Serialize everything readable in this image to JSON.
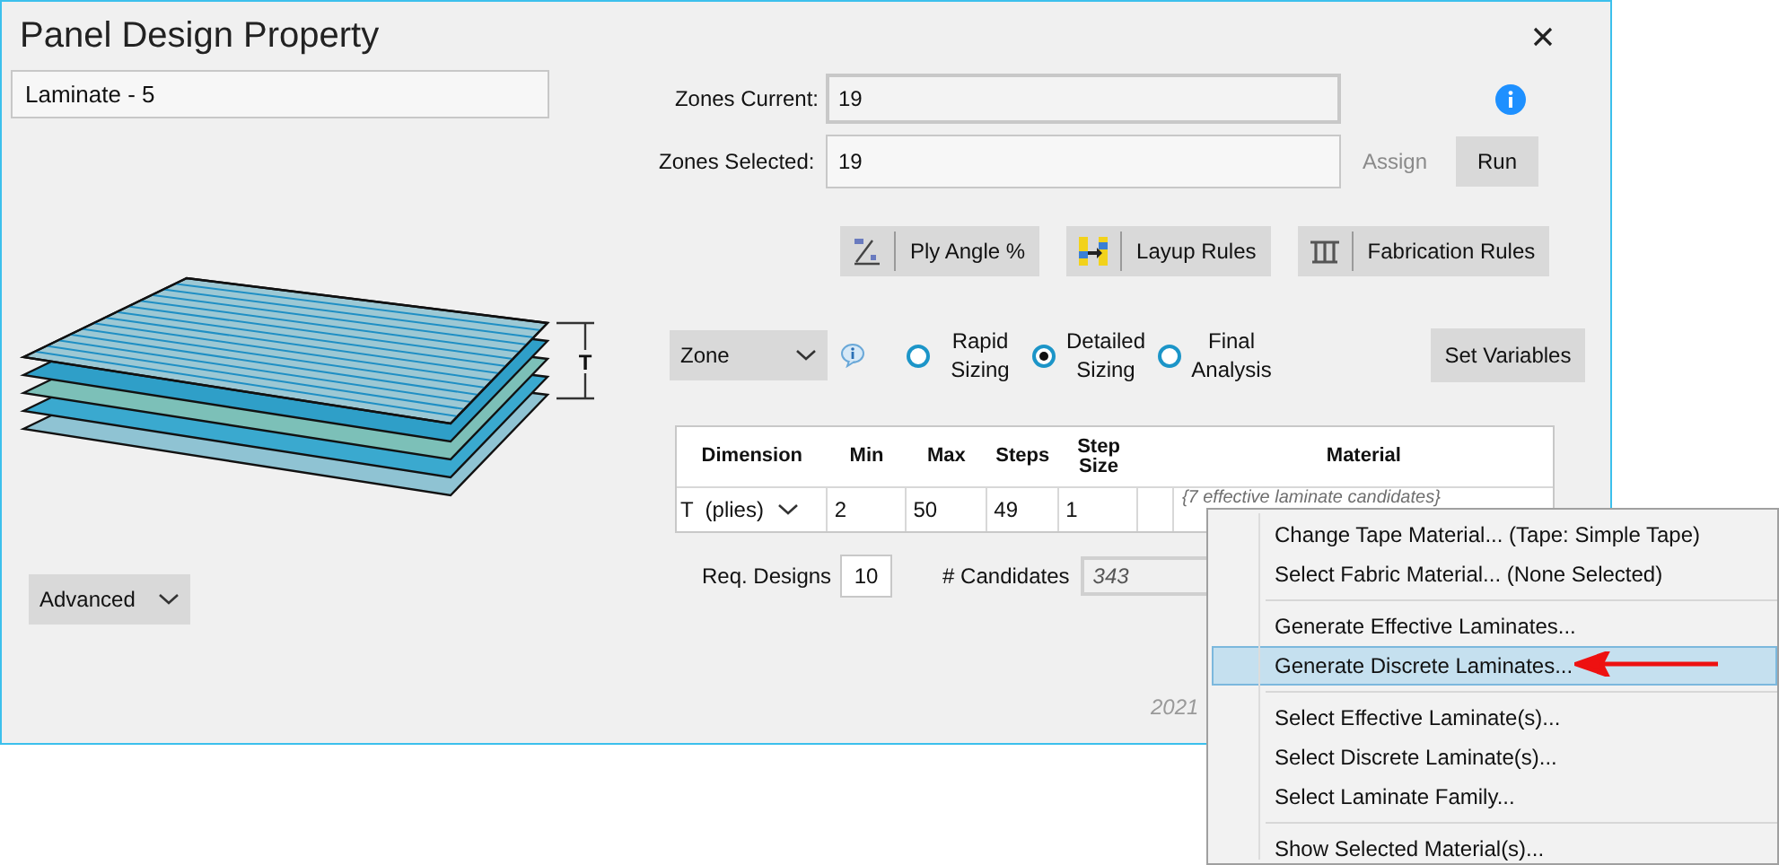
{
  "window": {
    "title": "Panel Design Property"
  },
  "name_field": {
    "value": "Laminate - 5"
  },
  "zones_current": {
    "label": "Zones Current:",
    "value": "19"
  },
  "zones_selected": {
    "label": "Zones Selected:",
    "value": "19"
  },
  "assign_button": {
    "label": "Assign",
    "disabled": true
  },
  "run_button": {
    "label": "Run"
  },
  "rule_buttons": [
    {
      "label": "Ply Angle %",
      "kind": "ply-angle"
    },
    {
      "label": "Layup Rules",
      "kind": "layup"
    },
    {
      "label": "Fabrication Rules",
      "kind": "fabrication"
    }
  ],
  "scope_dropdown": {
    "value": "Zone"
  },
  "analysis_modes": [
    {
      "label": "Rapid Sizing",
      "selected": false
    },
    {
      "label": "Detailed Sizing",
      "selected": true
    },
    {
      "label": "Final Analysis",
      "selected": false
    }
  ],
  "set_variables_button": {
    "label": "Set Variables"
  },
  "thickness_label": "T",
  "advanced_dropdown": {
    "label": "Advanced"
  },
  "table": {
    "columns": [
      "Dimension",
      "Min",
      "Max",
      "Steps",
      "Step Size",
      "Material"
    ],
    "rows": [
      {
        "dimension": "T  (plies)",
        "min": "2",
        "max": "50",
        "steps": "49",
        "step_size": "1",
        "material": "{7 effective laminate candidates}"
      }
    ]
  },
  "req_designs": {
    "label": "Req. Designs",
    "value": "10"
  },
  "candidates": {
    "label": "# Candidates",
    "value": "343"
  },
  "footer_text": "2021",
  "context_menu": {
    "groups": [
      {
        "items": [
          {
            "label": "Change Tape Material... (Tape: Simple Tape)",
            "selected": false
          },
          {
            "label": "Select Fabric Material... (None Selected)",
            "selected": false
          }
        ]
      },
      {
        "items": [
          {
            "label": "Generate Effective Laminates...",
            "selected": false
          },
          {
            "label": "Generate Discrete Laminates...",
            "selected": true
          }
        ]
      },
      {
        "items": [
          {
            "label": "Select Effective Laminate(s)...",
            "selected": false
          },
          {
            "label": "Select Discrete Laminate(s)...",
            "selected": false
          },
          {
            "label": "Select Laminate Family...",
            "selected": false
          }
        ]
      },
      {
        "items": [
          {
            "label": "Show Selected Material(s)...",
            "selected": false
          }
        ]
      }
    ]
  }
}
